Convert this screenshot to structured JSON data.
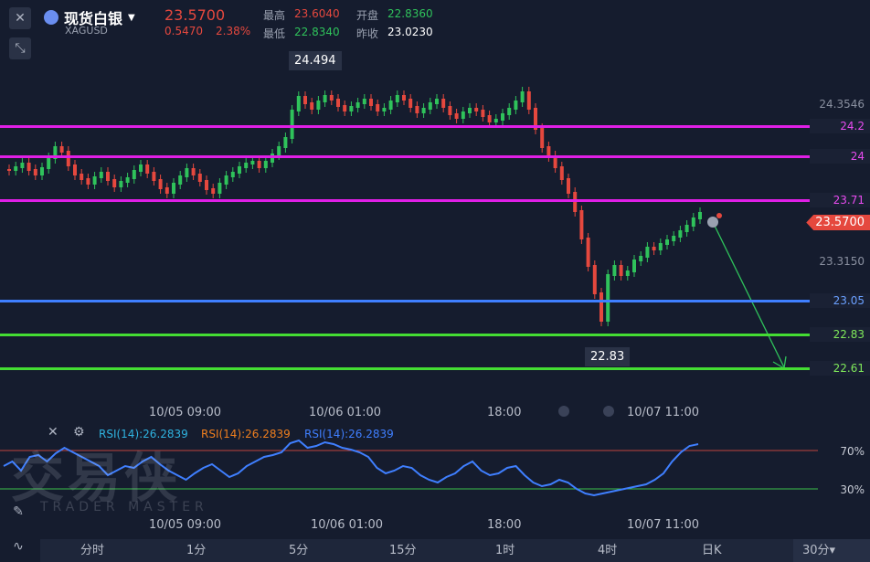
{
  "header": {
    "name": "现货白银",
    "symbol": "XAGUSD",
    "price": "23.5700",
    "change": "0.5470",
    "change_pct": "2.38%",
    "high_label": "最高",
    "high": "23.6040",
    "low_label": "最低",
    "low": "22.8340",
    "open_label": "开盘",
    "open": "22.8360",
    "prev_label": "昨收",
    "prev": "23.0230"
  },
  "chart": {
    "axis_prices": [
      "24.3546",
      "23.3150"
    ],
    "current_price": "23.5700",
    "max_label": "24.494",
    "min_label": "22.83",
    "lines": [
      {
        "label": "24.2",
        "color": "#e01fe6"
      },
      {
        "label": "24",
        "color": "#e01fe6"
      },
      {
        "label": "23.71",
        "color": "#e01fe6"
      },
      {
        "label": "23.05",
        "color": "#3f7fff"
      },
      {
        "label": "22.83",
        "color": "#44dd33"
      },
      {
        "label": "22.61",
        "color": "#44dd33"
      }
    ],
    "time_labels": [
      "10/05 09:00",
      "10/06 01:00",
      "18:00",
      "10/07 11:00"
    ]
  },
  "rsi": {
    "labels": [
      "RSI(14):26.2839",
      "RSI(14):26.2839",
      "RSI(14):26.2839"
    ],
    "label_colors": [
      "#2fb3e0",
      "#f07f1e",
      "#3f7fff"
    ],
    "upper": "70%",
    "lower": "30%",
    "time_labels": [
      "10/05 09:00",
      "10/06 01:00",
      "18:00",
      "10/07 11:00"
    ]
  },
  "watermark": {
    "big": "交易侠",
    "small": "TRADER MASTER"
  },
  "bottom": {
    "periods": [
      "分时",
      "1分",
      "5分",
      "15分",
      "1时",
      "4时",
      "日K",
      "30分"
    ],
    "dropdown": "30分▾"
  }
}
